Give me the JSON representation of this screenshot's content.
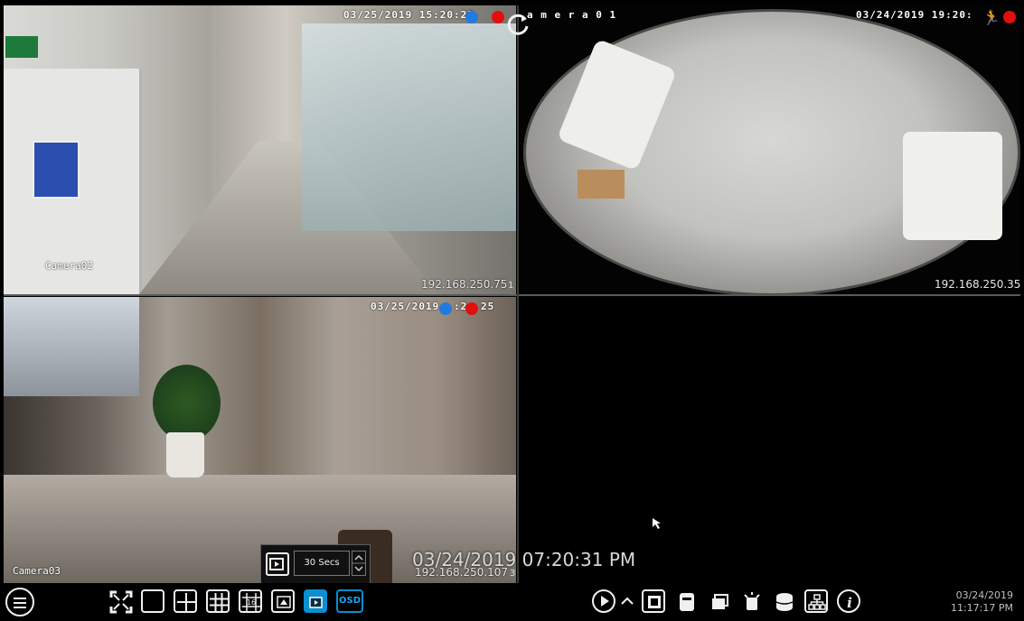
{
  "cameras": [
    {
      "name": "Camera02",
      "timestamp": "03/25/2019 15:20:25",
      "ip": "192.168.250.75",
      "channel": "1"
    },
    {
      "name": "a m e r a 0 1",
      "timestamp": "03/24/2019 19:20:",
      "ip": "192.168.250.35",
      "channel": ""
    },
    {
      "name": "Camera03",
      "timestamp": "03/25/2019",
      "timestamp_tail": ":2",
      "timestamp_end": "25",
      "ip": "192.168.250.107",
      "channel": "3"
    }
  ],
  "overlay_time": "03/24/2019 07:20:31 PM",
  "dwell": {
    "value": "30 Secs"
  },
  "toolbar": {
    "osd_label": "OSD",
    "clock_date": "03/24/2019",
    "clock_time": "11:17:17 PM",
    "accent_color": "#0b8fd0"
  }
}
